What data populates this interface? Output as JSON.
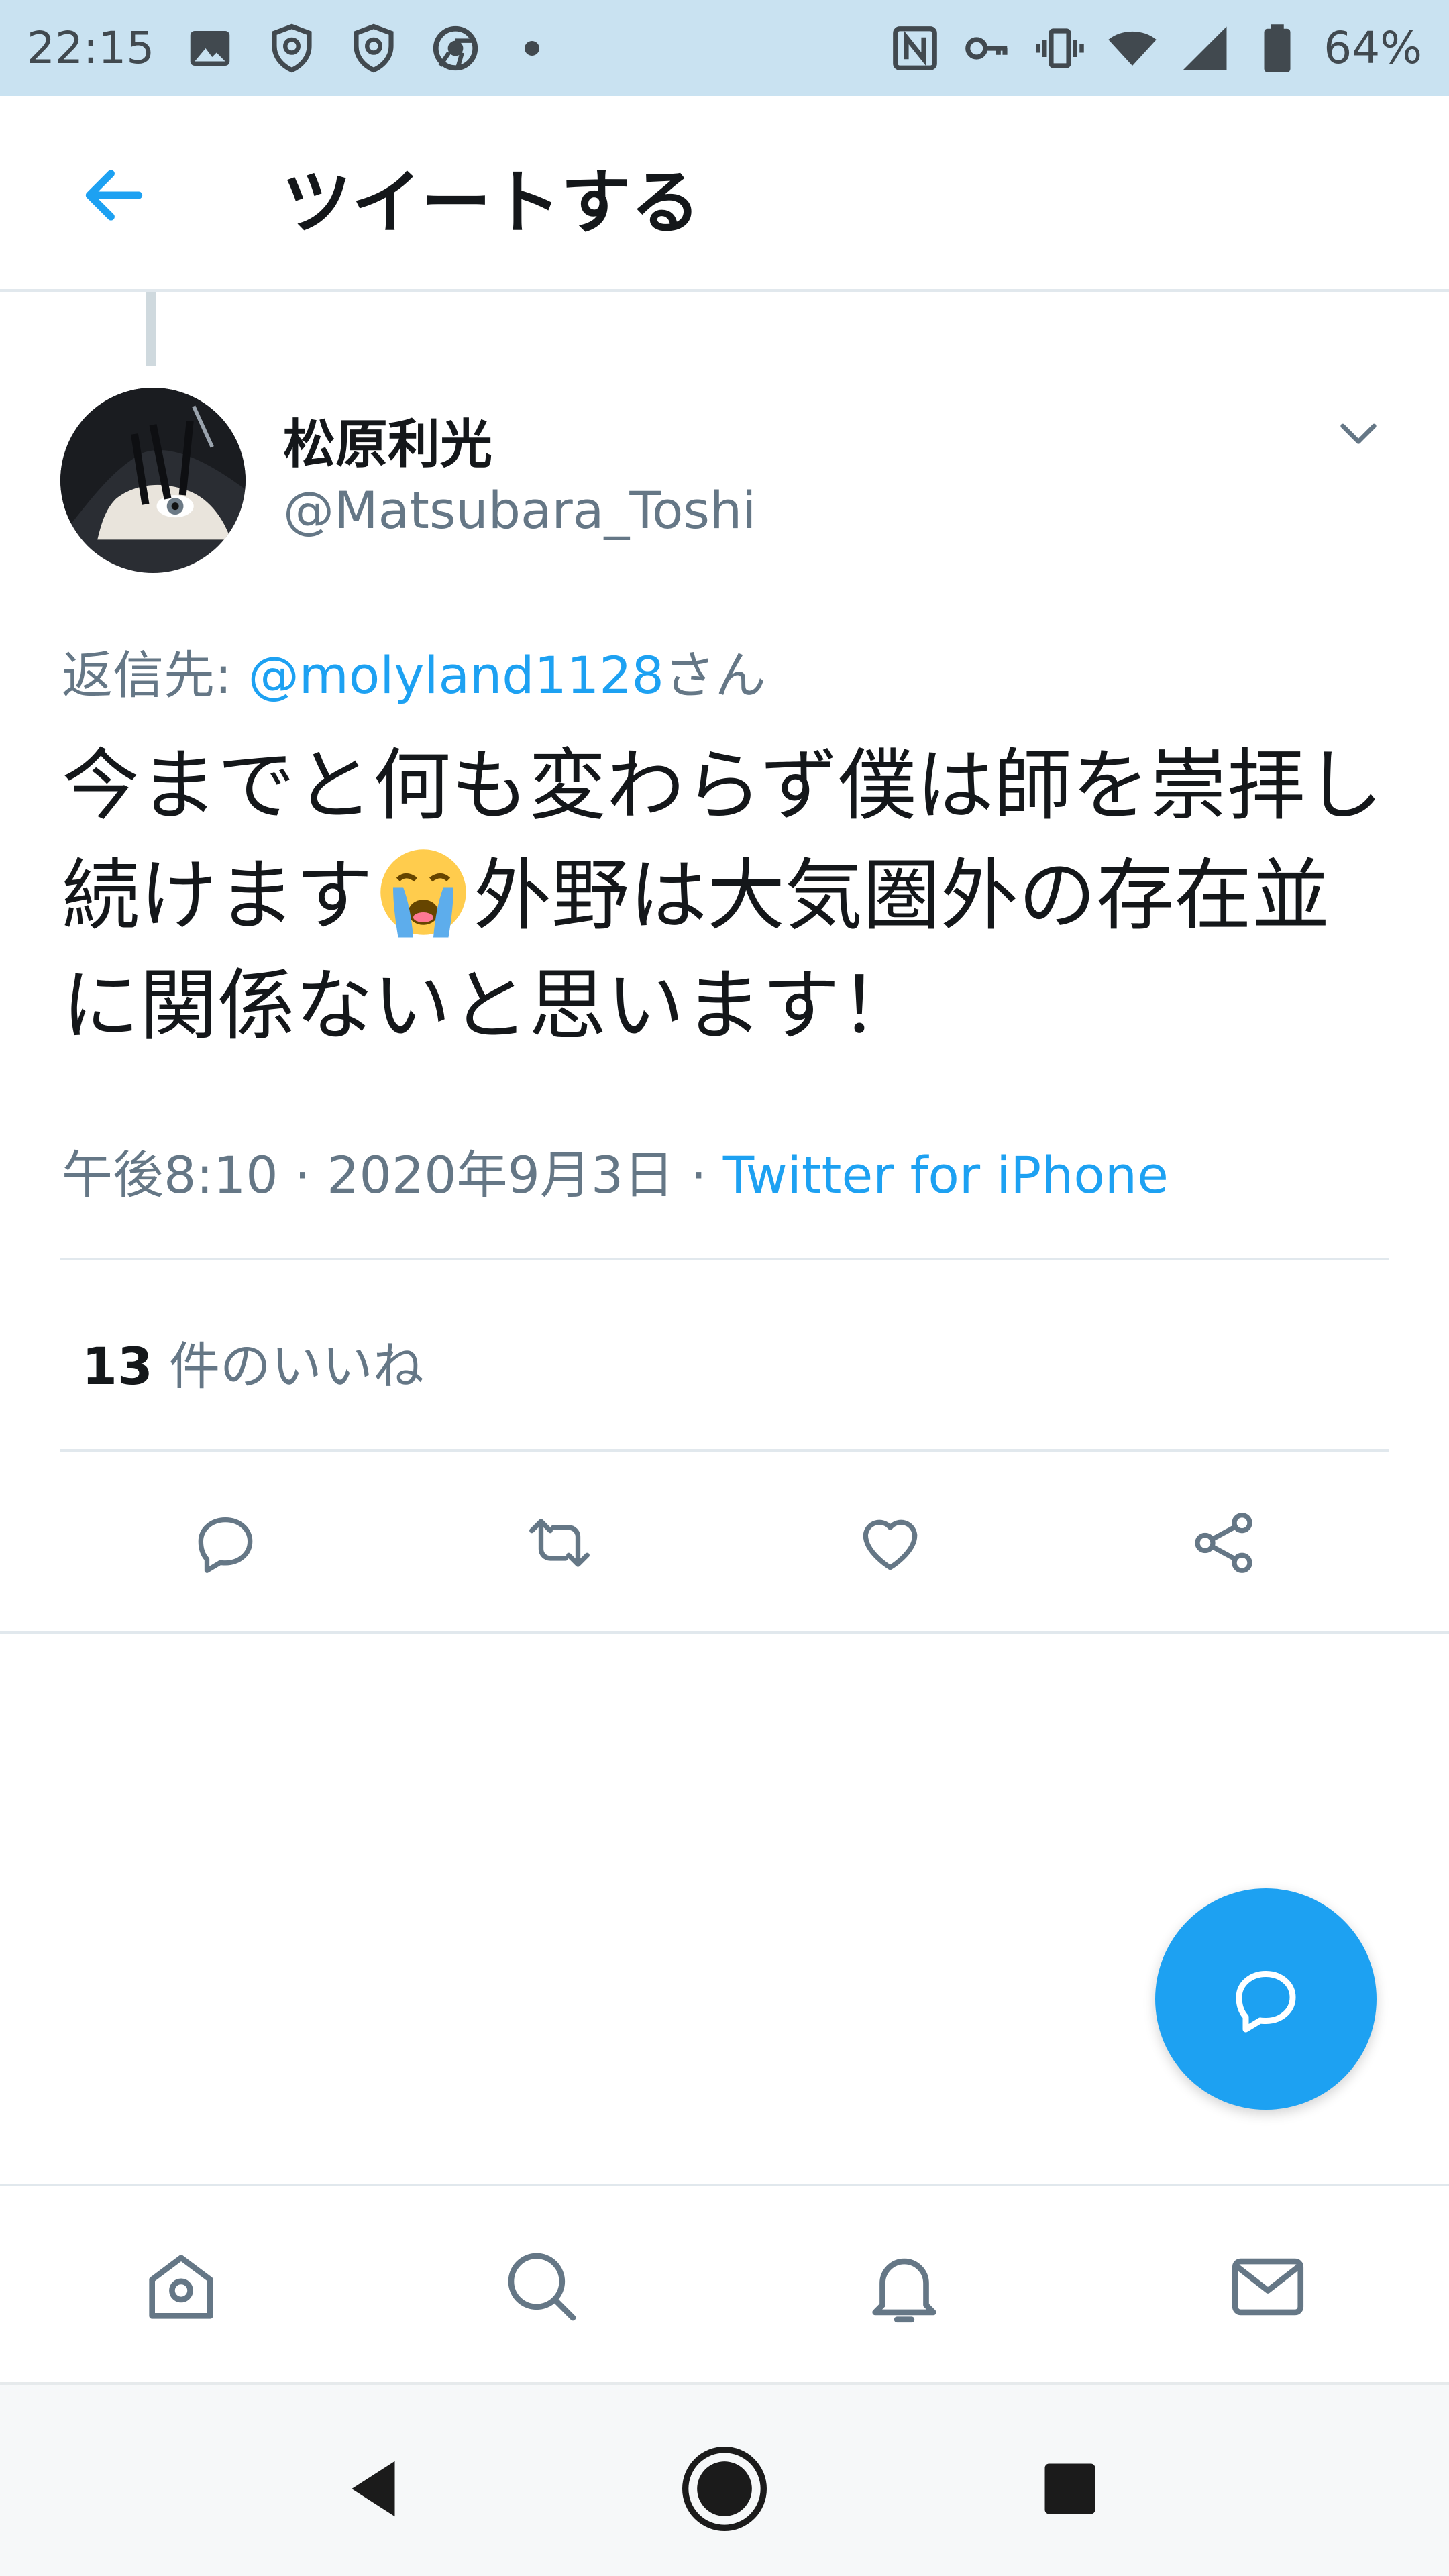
{
  "status_bar": {
    "time": "22:15",
    "battery": "64%"
  },
  "header": {
    "title": "ツイートする"
  },
  "tweet": {
    "display_name": "松原利光",
    "handle": "@Matsubara_Toshi",
    "reply_prefix": "返信先: ",
    "reply_mention": "@molyland1128",
    "reply_suffix": "さん",
    "text_part1": "今までと何も変わらず僕は師を崇拝し続けます",
    "text_part2": "外野は大気圏外の存在並に関係ないと思います！",
    "timestamp": "午後8:10 · 2020年9月3日 · ",
    "source": "Twitter for iPhone",
    "likes_count": "13",
    "likes_label": " 件のいいね"
  },
  "colors": {
    "accent": "#1da1f2",
    "status_bar_bg": "#c9e2f1",
    "text_primary": "#14171a",
    "text_secondary": "#657786"
  },
  "icons": {
    "status": [
      "image-icon",
      "shield-icon",
      "shield-icon",
      "chrome-icon",
      "nfc-icon",
      "key-icon",
      "vibrate-icon",
      "wifi-icon",
      "signal-icon",
      "battery-icon"
    ],
    "actions": [
      "reply-icon",
      "retweet-icon",
      "like-icon",
      "share-icon"
    ],
    "tabs": [
      "home-icon",
      "search-icon",
      "notifications-icon",
      "messages-icon"
    ]
  }
}
